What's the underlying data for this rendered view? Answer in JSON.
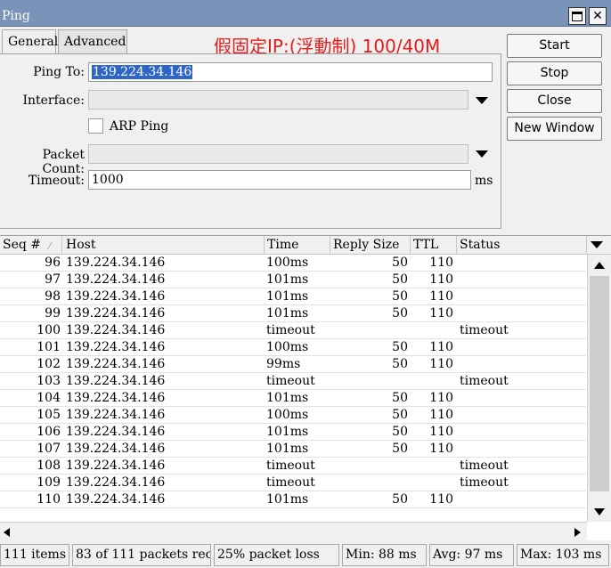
{
  "window": {
    "title": "Ping"
  },
  "tabs": [
    {
      "label": "General"
    },
    {
      "label": "Advanced"
    }
  ],
  "annotation": "假固定IP:(浮動制) 100/40M",
  "form": {
    "ping_to_label": "Ping To:",
    "ping_to_value": "139.224.34.146",
    "interface_label": "Interface:",
    "interface_value": "",
    "arp_ping_label": "ARP Ping",
    "arp_ping_checked": false,
    "packet_count_label": "Packet Count:",
    "packet_count_value": "",
    "timeout_label": "Timeout:",
    "timeout_value": "1000",
    "timeout_unit": "ms"
  },
  "buttons": {
    "start": "Start",
    "stop": "Stop",
    "close": "Close",
    "new_window": "New Window"
  },
  "table": {
    "headers": {
      "seq": "Seq #",
      "host": "Host",
      "time": "Time",
      "reply_size": "Reply Size",
      "ttl": "TTL",
      "status": "Status"
    },
    "rows": [
      {
        "seq": "96",
        "host": "139.224.34.146",
        "time": "100ms",
        "reply_size": "50",
        "ttl": "110",
        "status": ""
      },
      {
        "seq": "97",
        "host": "139.224.34.146",
        "time": "101ms",
        "reply_size": "50",
        "ttl": "110",
        "status": ""
      },
      {
        "seq": "98",
        "host": "139.224.34.146",
        "time": "101ms",
        "reply_size": "50",
        "ttl": "110",
        "status": ""
      },
      {
        "seq": "99",
        "host": "139.224.34.146",
        "time": "101ms",
        "reply_size": "50",
        "ttl": "110",
        "status": ""
      },
      {
        "seq": "100",
        "host": "139.224.34.146",
        "time": "timeout",
        "reply_size": "",
        "ttl": "",
        "status": "timeout"
      },
      {
        "seq": "101",
        "host": "139.224.34.146",
        "time": "100ms",
        "reply_size": "50",
        "ttl": "110",
        "status": ""
      },
      {
        "seq": "102",
        "host": "139.224.34.146",
        "time": "99ms",
        "reply_size": "50",
        "ttl": "110",
        "status": ""
      },
      {
        "seq": "103",
        "host": "139.224.34.146",
        "time": "timeout",
        "reply_size": "",
        "ttl": "",
        "status": "timeout"
      },
      {
        "seq": "104",
        "host": "139.224.34.146",
        "time": "101ms",
        "reply_size": "50",
        "ttl": "110",
        "status": ""
      },
      {
        "seq": "105",
        "host": "139.224.34.146",
        "time": "100ms",
        "reply_size": "50",
        "ttl": "110",
        "status": ""
      },
      {
        "seq": "106",
        "host": "139.224.34.146",
        "time": "101ms",
        "reply_size": "50",
        "ttl": "110",
        "status": ""
      },
      {
        "seq": "107",
        "host": "139.224.34.146",
        "time": "101ms",
        "reply_size": "50",
        "ttl": "110",
        "status": ""
      },
      {
        "seq": "108",
        "host": "139.224.34.146",
        "time": "timeout",
        "reply_size": "",
        "ttl": "",
        "status": "timeout"
      },
      {
        "seq": "109",
        "host": "139.224.34.146",
        "time": "timeout",
        "reply_size": "",
        "ttl": "",
        "status": "timeout"
      },
      {
        "seq": "110",
        "host": "139.224.34.146",
        "time": "101ms",
        "reply_size": "50",
        "ttl": "110",
        "status": ""
      }
    ]
  },
  "statusbar": {
    "items": "111 items",
    "packets": "83 of 111 packets rec...",
    "loss": "25% packet loss",
    "min": "Min: 88 ms",
    "avg": "Avg: 97 ms",
    "max": "Max: 103 ms"
  },
  "colors": {
    "titlebar": "#7a93b8",
    "annotation": "#e41c1c",
    "selection": "#2f65c7"
  }
}
